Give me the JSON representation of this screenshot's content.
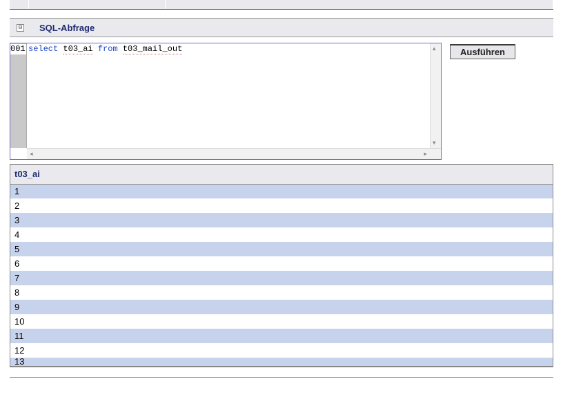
{
  "section": {
    "title": "SQL-Abfrage",
    "collapse_glyph": "⊟"
  },
  "editor": {
    "line_number": "001",
    "tokens": {
      "kw_select": "select",
      "col": "t03_ai",
      "kw_from": "from",
      "table": "t03_mail_out"
    }
  },
  "actions": {
    "run_label": "Ausführen"
  },
  "results": {
    "columns": [
      "t03_ai"
    ],
    "rows": [
      "1",
      "2",
      "3",
      "4",
      "5",
      "6",
      "7",
      "8",
      "9",
      "10",
      "11",
      "12",
      "13"
    ]
  }
}
